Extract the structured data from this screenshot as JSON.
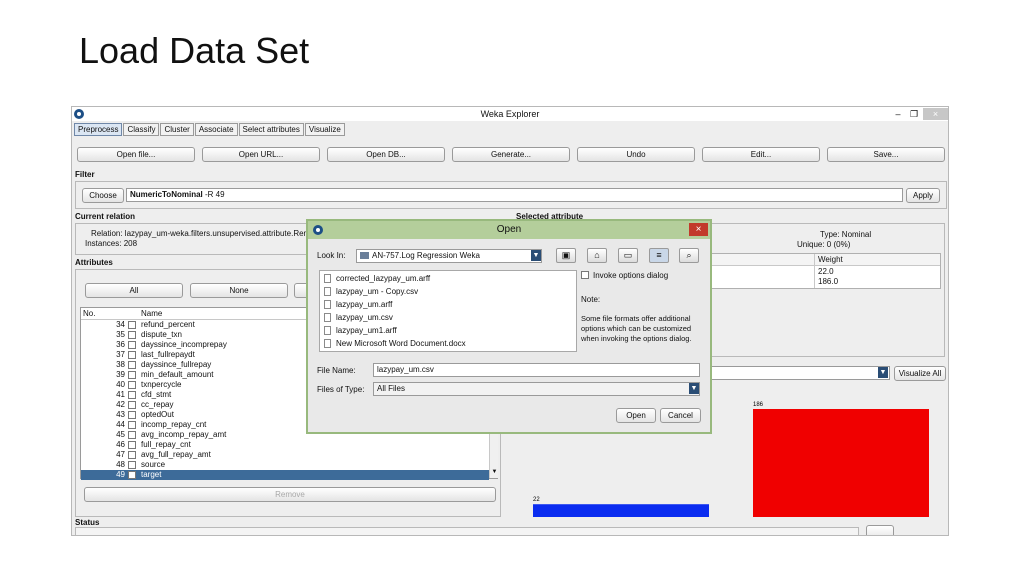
{
  "slide": {
    "title": "Load Data Set"
  },
  "window": {
    "title": "Weka Explorer",
    "minimize": "–",
    "restore": "❐",
    "close": "×"
  },
  "tabs": [
    "Preprocess",
    "Classify",
    "Cluster",
    "Associate",
    "Select attributes",
    "Visualize"
  ],
  "toolbar": [
    "Open file...",
    "Open URL...",
    "Open DB...",
    "Generate...",
    "Undo",
    "Edit...",
    "Save..."
  ],
  "filter": {
    "section": "Filter",
    "choose": "Choose",
    "name": "NumericToNominal",
    "options": "-R 49",
    "apply": "Apply"
  },
  "relation": {
    "section": "Current relation",
    "relation_text": "Relation: lazypay_um-weka.filters.unsupervised.attribute.Ren",
    "instances_text": "Instances: 208"
  },
  "attributes": {
    "section": "Attributes",
    "all": "All",
    "none": "None",
    "col_no": "No.",
    "col_name": "Name",
    "rows": [
      {
        "no": "34",
        "name": "refund_percent"
      },
      {
        "no": "35",
        "name": "dispute_txn"
      },
      {
        "no": "36",
        "name": "dayssince_incomprepay"
      },
      {
        "no": "37",
        "name": "last_fullrepaydt"
      },
      {
        "no": "38",
        "name": "dayssince_fullrepay"
      },
      {
        "no": "39",
        "name": "min_default_amount"
      },
      {
        "no": "40",
        "name": "txnpercycle"
      },
      {
        "no": "41",
        "name": "cfd_stmt"
      },
      {
        "no": "42",
        "name": "cc_repay"
      },
      {
        "no": "43",
        "name": "optedOut"
      },
      {
        "no": "44",
        "name": "incomp_repay_cnt"
      },
      {
        "no": "45",
        "name": "avg_incomp_repay_amt"
      },
      {
        "no": "46",
        "name": "full_repay_cnt"
      },
      {
        "no": "47",
        "name": "avg_full_repay_amt"
      },
      {
        "no": "48",
        "name": "source"
      },
      {
        "no": "49",
        "name": "target"
      }
    ],
    "remove": "Remove"
  },
  "selected": {
    "section": "Selected attribute",
    "type_text": "Type: Nominal",
    "unique_text": "Unique: 0 (0%)",
    "weight_header": "Weight",
    "weights": [
      "22.0",
      "186.0"
    ],
    "visualize_all": "Visualize All"
  },
  "chart_data": {
    "type": "bar",
    "categories": [
      "",
      ""
    ],
    "values": [
      22,
      186
    ],
    "labels": [
      "22",
      "186"
    ],
    "colors": [
      "#0a2cf0",
      "#f00000"
    ],
    "ylim": [
      0,
      186
    ]
  },
  "status": {
    "section": "Status"
  },
  "dialog": {
    "title": "Open",
    "close": "×",
    "look_in_label": "Look In:",
    "look_in_value": "AN-757.Log Regression Weka",
    "files": [
      "corrected_lazypay_um.arff",
      "lazypay_um - Copy.csv",
      "lazypay_um.arff",
      "lazypay_um.csv",
      "lazypay_um1.arff",
      "New Microsoft Word Document.docx"
    ],
    "invoke_label": "Invoke options dialog",
    "note_title": "Note:",
    "note_text": "Some file formats offer additional options which can be customized when invoking the options dialog.",
    "file_name_label": "File Name:",
    "file_name_value": "lazypay_um.csv",
    "files_of_type_label": "Files of Type:",
    "files_of_type_value": "All Files",
    "open": "Open",
    "cancel": "Cancel"
  }
}
